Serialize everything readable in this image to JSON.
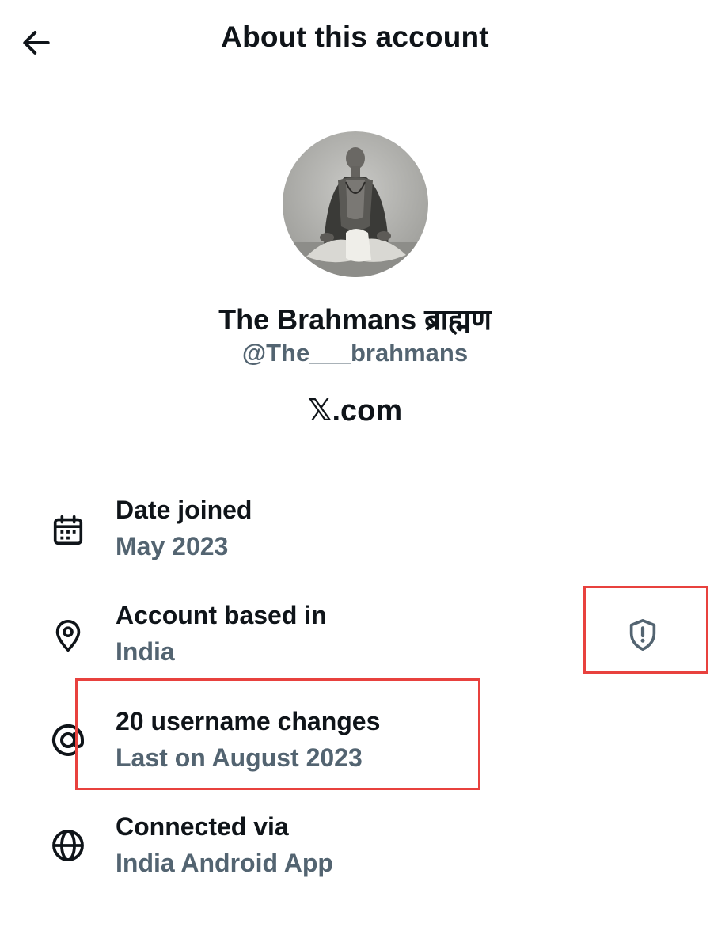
{
  "header": {
    "title": "About this account",
    "back_icon": "arrow-left-icon"
  },
  "profile": {
    "display_name": "The Brahmans ब्राह्मण",
    "handle": "@The___brahmans",
    "site": "𝕏.com",
    "avatar_icon": "profile-photo"
  },
  "details": [
    {
      "icon": "calendar-icon",
      "label": "Date joined",
      "value": "May 2023"
    },
    {
      "icon": "location-pin-icon",
      "label": "Account based in",
      "value": "India"
    },
    {
      "icon": "at-sign-icon",
      "label": "20 username changes",
      "value": "Last on August 2023"
    },
    {
      "icon": "globe-icon",
      "label": "Connected via",
      "value": "India Android App"
    }
  ],
  "badges": {
    "shield_icon": "shield-alert-icon"
  },
  "colors": {
    "text_primary": "#0f1419",
    "text_secondary": "#536471",
    "highlight": "#e8413e",
    "background": "#ffffff"
  }
}
